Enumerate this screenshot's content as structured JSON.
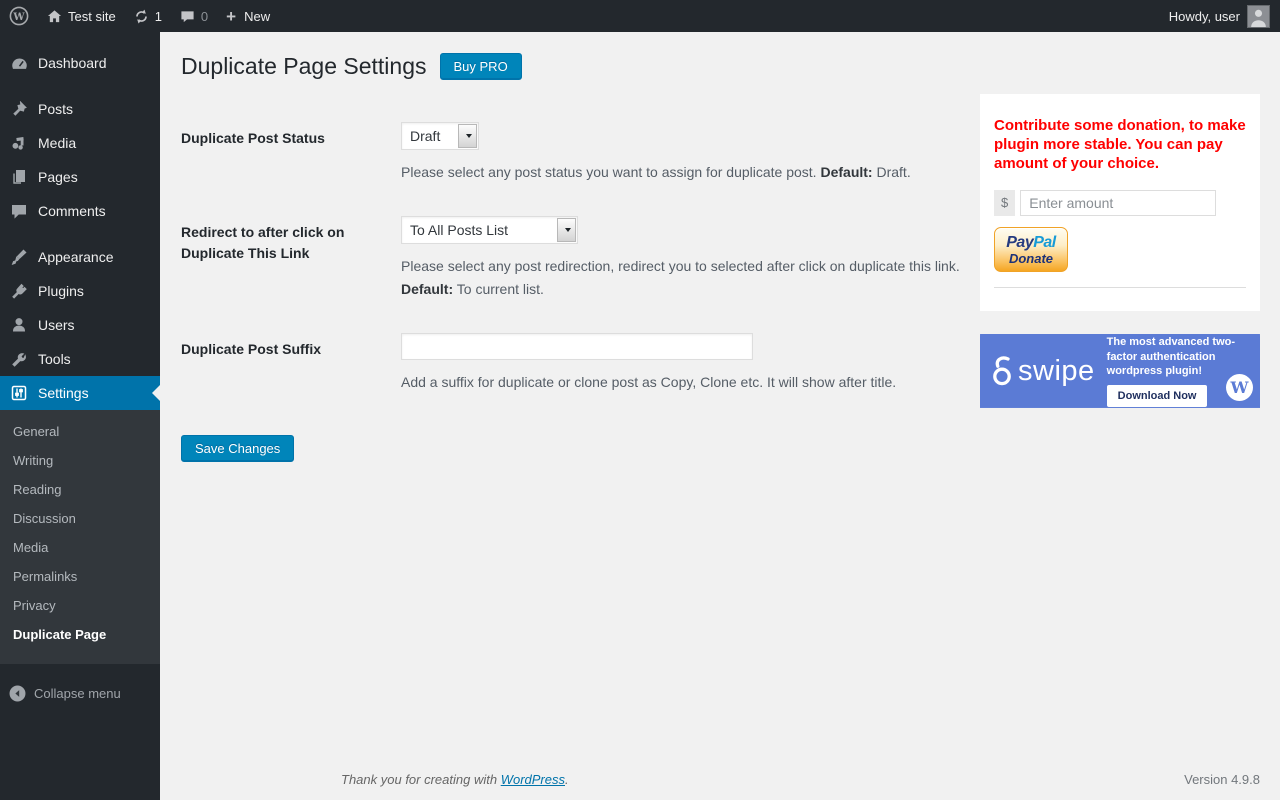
{
  "admin_bar": {
    "site_name": "Test site",
    "update_count": "1",
    "comment_count": "0",
    "new_label": "New",
    "howdy": "Howdy, user"
  },
  "sidebar": {
    "items": [
      {
        "label": "Dashboard"
      },
      {
        "label": "Posts"
      },
      {
        "label": "Media"
      },
      {
        "label": "Pages"
      },
      {
        "label": "Comments"
      },
      {
        "label": "Appearance"
      },
      {
        "label": "Plugins"
      },
      {
        "label": "Users"
      },
      {
        "label": "Tools"
      },
      {
        "label": "Settings"
      }
    ],
    "submenu": [
      "General",
      "Writing",
      "Reading",
      "Discussion",
      "Media",
      "Permalinks",
      "Privacy",
      "Duplicate Page"
    ],
    "collapse_label": "Collapse menu"
  },
  "main": {
    "title": "Duplicate Page Settings",
    "buy_pro_label": "Buy PRO",
    "rows": [
      {
        "label": "Duplicate Post Status",
        "control_value": "Draft",
        "desc": "Please select any post status you want to assign for duplicate post.",
        "default_label": "Default:",
        "default_value": "Draft."
      },
      {
        "label": "Redirect to after click on Duplicate This Link",
        "control_value": "To All Posts List",
        "desc": "Please select any post redirection, redirect you to selected after click on duplicate this link.",
        "default_label": "Default:",
        "default_value": "To current list."
      },
      {
        "label": "Duplicate Post Suffix",
        "input_value": "",
        "desc": "Add a suffix for duplicate or clone post as Copy, Clone etc. It will show after title."
      }
    ],
    "save_label": "Save Changes"
  },
  "donation": {
    "message": "Contribute some donation, to make plugin more stable. You can pay amount of your choice.",
    "currency": "$",
    "amount_placeholder": "Enter amount",
    "paypal_pay": "Pay",
    "paypal_pal": "Pal",
    "paypal_donate": "Donate"
  },
  "banner": {
    "brand": "swipe",
    "text": "The most advanced two-factor authentication wordpress plugin!",
    "button_label": "Download Now",
    "wp_mark": "W"
  },
  "footer": {
    "thanks_prefix": "Thank you for creating with ",
    "wordpress_link": "WordPress",
    "thanks_suffix": ".",
    "version": "Version 4.9.8"
  },
  "colors": {
    "admin_dark": "#23282d",
    "submenu_dark": "#32373c",
    "accent_blue": "#0073aa",
    "button_blue": "#0085ba",
    "donation_red": "#ff0000",
    "banner_blue": "#5b7bd5",
    "content_bg": "#f1f1f1"
  }
}
